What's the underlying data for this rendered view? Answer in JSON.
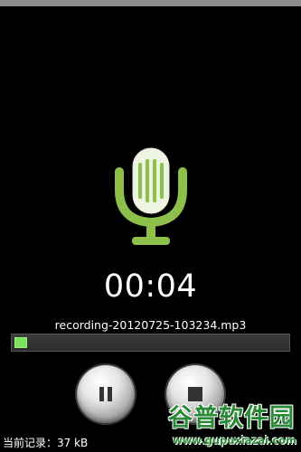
{
  "recorder": {
    "elapsed_time": "00:04",
    "file_name": "recording-20120725-103234.mp3",
    "progress_fraction": 0.045,
    "current_record_label": "当前记录：37 kB"
  },
  "controls": {
    "pause_icon": "pause-icon",
    "stop_icon": "stop-icon"
  },
  "icons": {
    "microphone": "microphone-icon"
  },
  "colors": {
    "accent_green": "#8cc04a",
    "progress_green": "#7be05a",
    "background": "#000000"
  },
  "watermark": {
    "title": "谷普软件园",
    "url": "www.gupuxiazai.com"
  }
}
